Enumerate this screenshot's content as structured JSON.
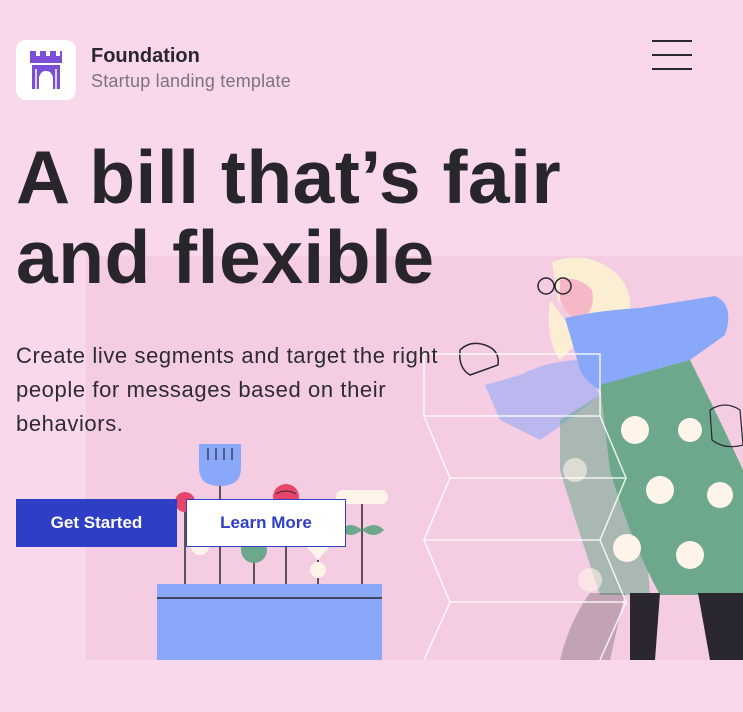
{
  "header": {
    "brand_name": "Foundation",
    "brand_tagline": "Startup landing template",
    "logo_icon": "castle-tower-icon",
    "menu_icon": "hamburger-menu-icon"
  },
  "hero": {
    "headline": "A bill that’s fair and flexible",
    "subtext": "Create live segments and target the right people for messages based on their behaviors.",
    "primary_button": "Get Started",
    "secondary_button": "Learn More"
  },
  "colors": {
    "page_background": "#f9d8ec",
    "accent": "#2e3ec6",
    "logo_purple": "#7a4fd6",
    "illustration_blue": "#8aa8f9",
    "illustration_green": "#6ea88c"
  }
}
